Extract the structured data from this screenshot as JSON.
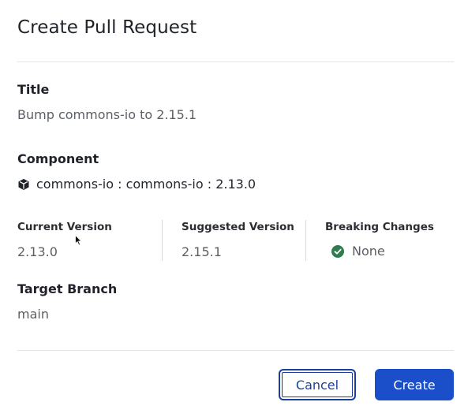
{
  "dialog": {
    "title": "Create Pull Request"
  },
  "fields": {
    "title_label": "Title",
    "title_value": "Bump commons-io to 2.15.1",
    "component_label": "Component",
    "component_icon": "package-icon",
    "component_value": "commons-io : commons-io : 2.13.0",
    "current_version_label": "Current Version",
    "current_version_value": "2.13.0",
    "suggested_version_label": "Suggested Version",
    "suggested_version_value": "2.15.1",
    "breaking_changes_label": "Breaking Changes",
    "breaking_changes_icon": "check-circle-icon",
    "breaking_changes_value": "None",
    "target_branch_label": "Target Branch",
    "target_branch_value": "main"
  },
  "actions": {
    "cancel_label": "Cancel",
    "create_label": "Create"
  },
  "colors": {
    "primary": "#1a4fc9",
    "success": "#2e7d4f"
  }
}
